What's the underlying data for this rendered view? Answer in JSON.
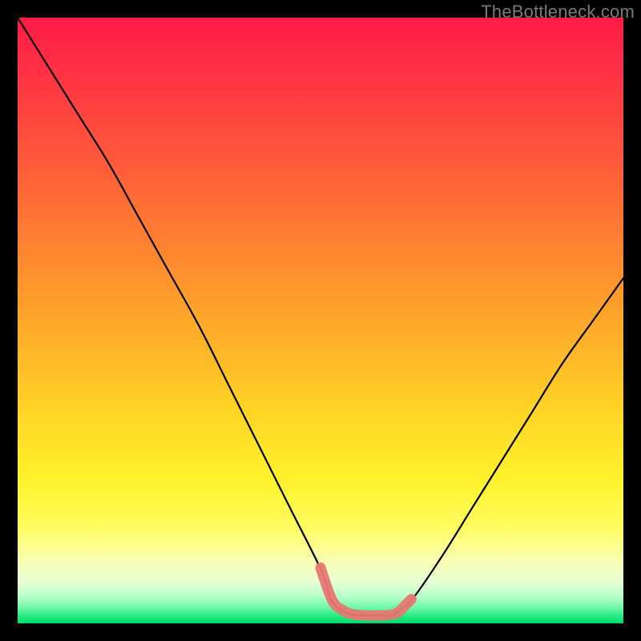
{
  "watermark": "TheBottleneck.com",
  "chart_data": {
    "type": "line",
    "title": "",
    "xlabel": "",
    "ylabel": "",
    "xlim": [
      0,
      100
    ],
    "ylim": [
      0,
      100
    ],
    "grid": false,
    "series": [
      {
        "name": "curve-black",
        "color": "#000000",
        "x": [
          0,
          5,
          10,
          15,
          20,
          25,
          30,
          35,
          40,
          45,
          50,
          52,
          55,
          58,
          60,
          62,
          65,
          70,
          75,
          80,
          85,
          90,
          95,
          100
        ],
        "values": [
          100,
          92,
          84,
          76,
          67,
          58,
          49,
          39,
          29,
          19,
          9,
          3.5,
          1.5,
          1.3,
          1.3,
          1.5,
          3.8,
          11,
          19,
          27,
          35,
          43,
          50,
          57
        ]
      },
      {
        "name": "marker-pink",
        "color": "#e77772",
        "x": [
          50,
          52,
          54,
          55,
          56,
          58,
          60,
          62,
          63,
          64,
          65
        ],
        "values": [
          9.2,
          3.7,
          2.0,
          1.6,
          1.4,
          1.3,
          1.3,
          1.5,
          2.0,
          3.0,
          4.0
        ]
      }
    ]
  }
}
